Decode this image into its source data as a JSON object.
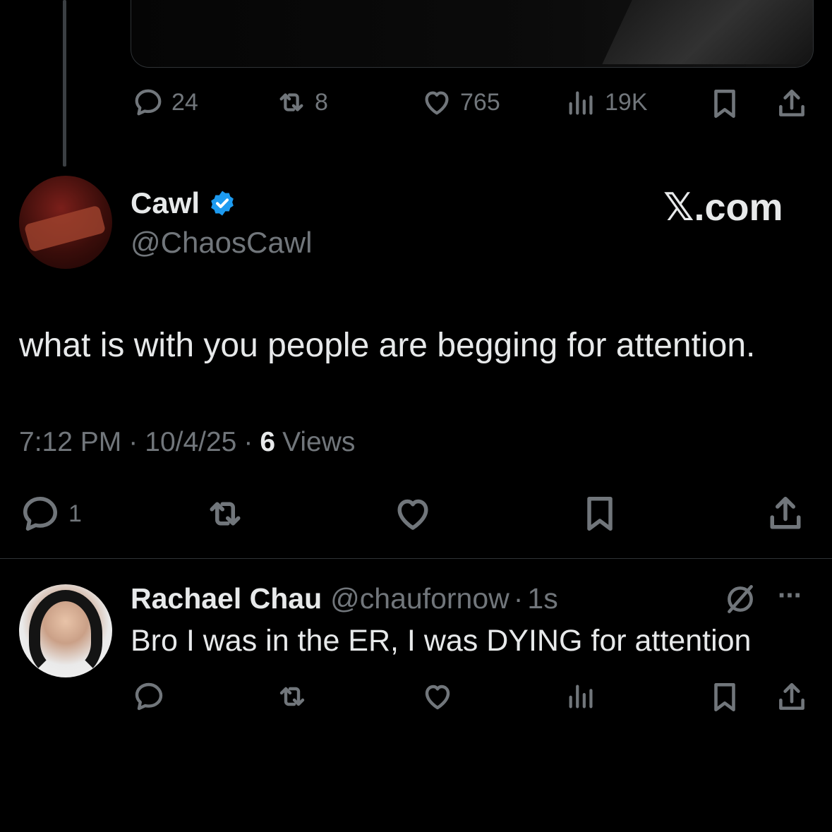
{
  "parent_tweet": {
    "actions": {
      "replies": "24",
      "reposts": "8",
      "likes": "765",
      "views": "19K"
    }
  },
  "main_tweet": {
    "author_name": "Cawl",
    "handle": "@ChaosCawl",
    "watermark": "𝕏.com",
    "text": "what is with you people are begging for attention.",
    "time": "7:12 PM",
    "date": "10/4/25",
    "views_count": "6",
    "views_label": "Views",
    "sep": "·",
    "actions": {
      "replies": "1"
    }
  },
  "reply_tweet": {
    "author_name": "Rachael Chau",
    "handle": "@chaufornow",
    "sep": "·",
    "time_ago": "1s",
    "text": "Bro I was in the ER, I was DYING for attention",
    "more": "···"
  },
  "colors": {
    "background": "#000000",
    "text": "#e7e9ea",
    "muted": "#71767b",
    "verified": "#1d9bf0",
    "divider": "#2f3336"
  }
}
